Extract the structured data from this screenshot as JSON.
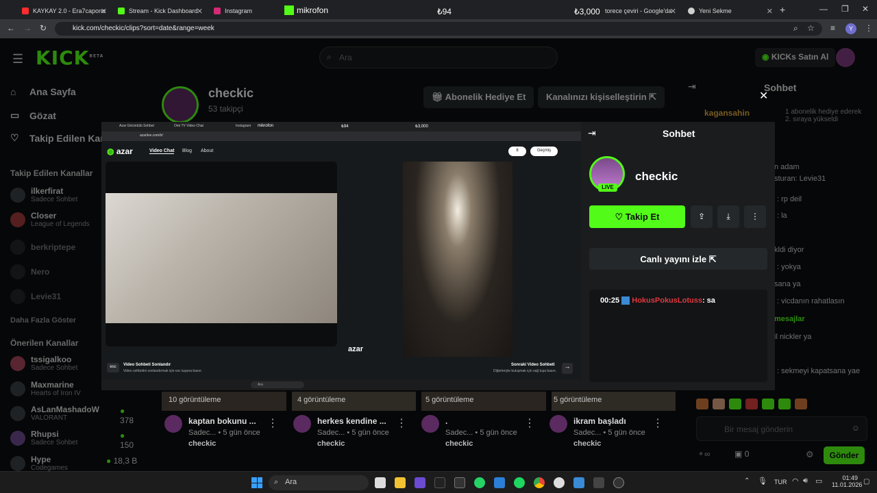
{
  "browser": {
    "tabs": [
      {
        "label": "KAYKAY 2.0 - Era7capone",
        "color": "#ff2d2d"
      },
      {
        "label": "Stream - Kick Dashboard",
        "color": "#53fc18"
      },
      {
        "label": "Instagram",
        "color": "#d62976"
      },
      {
        "label": "mikrofon",
        "color": "#53fc18"
      },
      {
        "label": "₺94",
        "color": ""
      },
      {
        "label": "₺3,000",
        "color": ""
      },
      {
        "label": "torece çeviri - Google'da",
        "color": "#4285f4"
      },
      {
        "label": "Yeni Sekme",
        "color": "#cfcfcf"
      }
    ],
    "url": "kick.com/checkic/clips?sort=date&range=week"
  },
  "kick": {
    "logo": "KICK",
    "logo_badge": "BETA",
    "search_placeholder": "Ara",
    "buy_kicks": "KICKs Satın Al",
    "nav": [
      "Ana Sayfa",
      "Gözat",
      "Takip Edilen Kan"
    ],
    "followed_title": "Takip Edilen Kanallar",
    "followed": [
      {
        "name": "ilkerfirat",
        "sub": "Sadece Sohbet"
      },
      {
        "name": "Closer",
        "sub": "League of Legends"
      },
      {
        "name": "berkriptepe",
        "sub": ""
      },
      {
        "name": "Nero",
        "sub": ""
      },
      {
        "name": "Levie31",
        "sub": ""
      }
    ],
    "show_more": "Daha Fazla Göster",
    "suggested_title": "Önerilen Kanallar",
    "suggested": [
      {
        "name": "tssigalkoo",
        "sub": "Sadece Sohbet",
        "viewers": ""
      },
      {
        "name": "Maxmarine",
        "sub": "Hearts of Iron IV",
        "viewers": ""
      },
      {
        "name": "AsLanMashadoW",
        "sub": "VALORANT",
        "viewers": "378"
      },
      {
        "name": "Rhupsi",
        "sub": "Sadece Sohbet",
        "viewers": "150"
      },
      {
        "name": "Hype",
        "sub": "Codegames",
        "viewers": "18,3 B"
      }
    ],
    "channel_name": "checkic",
    "followers": "53 takipçi",
    "gift_sub": "Abonelik Hediye Et",
    "customize": "Kanalınızı kişiselleştirin",
    "chat_title": "Sohbet",
    "chat_lines": [
      {
        "user": "kagansahin",
        "text": "1 abonelik hediye ederek 2. sıraya yükseldi"
      },
      {
        "user": "",
        "text": "n adam"
      },
      {
        "user": "",
        "text": "sturan: Levie31"
      },
      {
        "user": "",
        "text": ": rp deil"
      },
      {
        "user": "",
        "text": ": la"
      },
      {
        "user": "",
        "text": "kldi diyor"
      },
      {
        "user": "",
        "text": ": yokya"
      },
      {
        "user": "",
        "text": "sana ya"
      },
      {
        "user": "",
        "text": ": vicdanın rahatlasın"
      },
      {
        "user": "",
        "text": "mesajlar"
      },
      {
        "user": "",
        "text": "il nickler ya"
      },
      {
        "user": "",
        "text": ": sekmeyi kapatsana yae"
      }
    ],
    "chat_placeholder": "Bir mesaj gönderin",
    "points": "0",
    "send": "Gönder",
    "clips": [
      {
        "views": "10 görüntüleme",
        "title": "kaptan bokunu ...",
        "sub": "Sadec...",
        "age": "5 gün önce",
        "channel": "checkic"
      },
      {
        "views": "4 görüntüleme",
        "title": "herkes kendine ...",
        "sub": "Sadec...",
        "age": "5 gün önce",
        "channel": "checkic"
      },
      {
        "views": "5 görüntüleme",
        "title": ".",
        "sub": "Sadec...",
        "age": "5 gün önce",
        "channel": "checkic"
      },
      {
        "views": "5 görüntüleme",
        "title": "ikram başladı",
        "sub": "Sadec...",
        "age": "5 gün önce",
        "channel": "checkic"
      }
    ]
  },
  "overlay": {
    "inner_tabs": [
      "Azar Görüntülü Sohbet",
      "Omi TV Video Chat",
      "Instagram",
      "mikrofon",
      "₺94",
      "₺3,000"
    ],
    "inner_url": "azarlive.com/tr/",
    "azar_logo": "azar",
    "azar_nav": [
      "Video Chat",
      "Blog",
      "About"
    ],
    "gems": "8",
    "history": "Geçmiş",
    "esc_key": "esc",
    "end_title": "Video Sohbeti Sonlandır",
    "end_sub": "Video sohbetini sonlandırmak için esc tuşuna basın.",
    "next_title": "Sonraki Video Sohbeti",
    "next_sub": "Diğerleriyle buluşmak için sağ tuşa basın.",
    "chat_title": "Sohbet",
    "channel": "checkic",
    "live": "LIVE",
    "follow": "Takip Et",
    "watch_live": "Canlı yayını izle",
    "chat_time": "00:25",
    "chat_user": "HokusPokusLotuss",
    "chat_text": ": sa"
  },
  "taskbar": {
    "search": "Ara",
    "lang": "TUR",
    "time": "01:49",
    "date": "11.01.2026"
  },
  "colors": {
    "kick_green": "#53fc18",
    "bg": "#0b0e0f"
  }
}
